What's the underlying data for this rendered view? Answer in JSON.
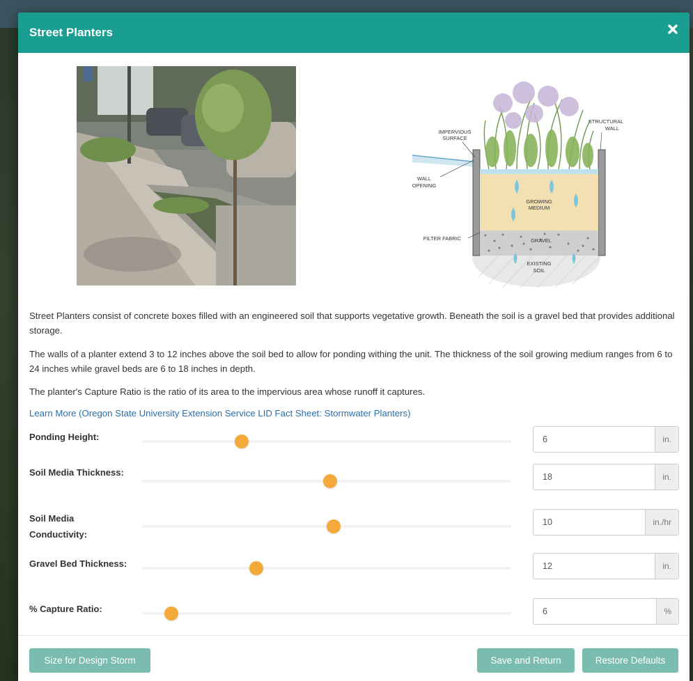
{
  "modal": {
    "title": "Street Planters",
    "description": [
      "Street Planters consist of concrete boxes filled with an engineered soil that supports vegetative growth. Beneath the soil is a gravel bed that provides additional storage.",
      "The walls of a planter extend 3 to 12 inches above the soil bed to allow for ponding withing the unit. The thickness of the soil growing medium ranges from 6 to 24 inches while gravel beds are 6 to 18 inches in depth.",
      "The planter's Capture Ratio is the ratio of its area to the impervious area whose runoff it captures."
    ],
    "learn_more": "Learn More (Oregon State University Extension Service LID Fact Sheet: Stormwater Planters)",
    "diagram_labels": {
      "impervious": "IMPERVIOUS",
      "surface": "SURFACE",
      "structural": "STRUCTURAL",
      "wall": "WALL",
      "wall2": "WALL",
      "opening": "OPENING",
      "growing": "GROWING",
      "medium": "MEDIUM",
      "filter": "FILTER FABRIC",
      "gravel": "GRAVEL",
      "existing": "EXISTING",
      "soil": "SOIL"
    }
  },
  "params": [
    {
      "label": "Ponding Height:",
      "value": "6",
      "unit": "in.",
      "slider_fraction": 0.25
    },
    {
      "label": "Soil Media Thickness:",
      "value": "18",
      "unit": "in.",
      "slider_fraction": 0.49
    },
    {
      "label": "Soil Media Conductivity:",
      "value": "10",
      "unit": "in./hr",
      "slider_fraction": 0.5
    },
    {
      "label": "Gravel Bed Thickness:",
      "value": "12",
      "unit": "in.",
      "slider_fraction": 0.29
    },
    {
      "label": "% Capture Ratio:",
      "value": "6",
      "unit": "%",
      "slider_fraction": 0.06
    }
  ],
  "buttons": {
    "design_storm": "Size for Design Storm",
    "save": "Save and Return",
    "restore": "Restore Defaults"
  },
  "colors": {
    "header": "#1a9e92",
    "slider_thumb": "#f5a93a",
    "button": "#7bbcb0",
    "link": "#2a6fb0"
  },
  "icons": {
    "close": "close-icon"
  }
}
